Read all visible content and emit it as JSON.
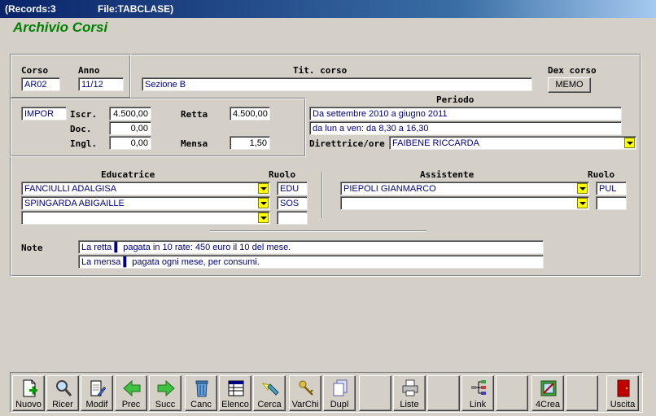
{
  "window": {
    "records": "(Records:3",
    "file": "File:TABCLASE)"
  },
  "app_title": "Archivio Corsi",
  "course": {
    "corso_label": "Corso",
    "corso": "AR02",
    "anno_label": "Anno",
    "anno": "11/12",
    "tit_label": "Tit. corso",
    "tit": "Sezione B",
    "dex_label": "Dex corso",
    "memo_label": "MEMO"
  },
  "fees": {
    "tipo": "IMPOR",
    "iscr_label": "Iscr.",
    "iscr": "4.500,00",
    "doc_label": "Doc.",
    "doc": "0,00",
    "ingl_label": "Ingl.",
    "ingl": "0,00",
    "retta_label": "Retta",
    "retta": "4.500,00",
    "mensa_label": "Mensa",
    "mensa": "1,50"
  },
  "periodo": {
    "label": "Periodo",
    "line1": "Da settembre 2010 a giugno 2011",
    "line2": "da lun a ven: da 8,30 a 16,30",
    "direttrice_label": "Direttrice/ore",
    "direttrice": "FAIBENE RICCARDA"
  },
  "educatrice": {
    "label": "Educatrice",
    "ruolo_label": "Ruolo",
    "rows": [
      {
        "name": "FANCIULLI ADALGISA",
        "ruolo": "EDU"
      },
      {
        "name": "SPINGARDA ABIGAILLE",
        "ruolo": "SOS"
      },
      {
        "name": "",
        "ruolo": ""
      }
    ]
  },
  "assistente": {
    "label": "Assistente",
    "ruolo_label": "Ruolo",
    "rows": [
      {
        "name": "PIEPOLI GIANMARCO",
        "ruolo": "PUL"
      },
      {
        "name": "",
        "ruolo": ""
      }
    ]
  },
  "note": {
    "label": "Note",
    "line1": "La retta ▌ pagata in 10 rate: 450 euro il 10 del mese.",
    "line2": "La mensa ▌ pagata ogni mese, per consumi."
  },
  "toolbar": {
    "nuovo": "Nuovo",
    "ricer": "Ricer",
    "modif": "Modif",
    "prec": "Prec",
    "succ": "Succ",
    "canc": "Canc",
    "elenco": "Elenco",
    "cerca": "Cerca",
    "varchi": "VarChi",
    "dupl": "Dupl",
    "liste": "Liste",
    "link": "Link",
    "crea": "4Crea",
    "uscita": "Uscita"
  }
}
